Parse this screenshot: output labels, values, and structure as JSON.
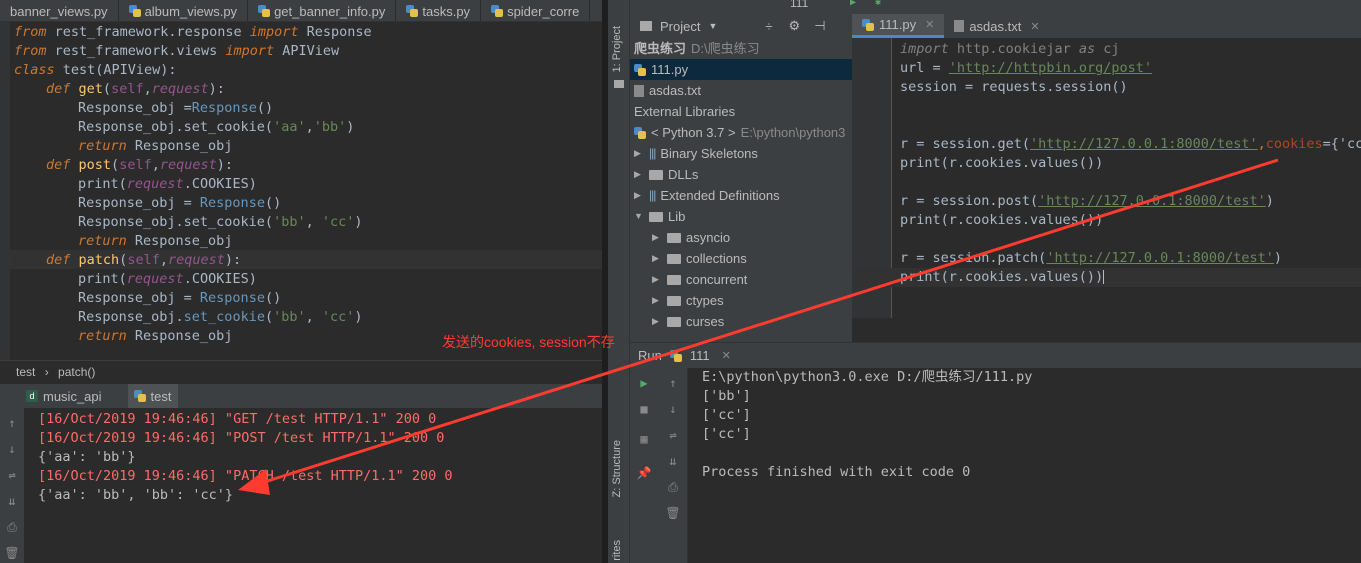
{
  "left_editor": {
    "tabs": [
      {
        "label": "banner_views.py"
      },
      {
        "label": "album_views.py"
      },
      {
        "label": "get_banner_info.py"
      },
      {
        "label": "tasks.py"
      },
      {
        "label": "spider_corre"
      }
    ],
    "code": {
      "l1": {
        "kw": "from",
        "mod": " rest_framework.response ",
        "imp": "import",
        "name": " Response"
      },
      "l2": {
        "kw": "from",
        "mod": " rest_framework.views ",
        "imp": "import",
        "name": " APIView"
      },
      "l3": {
        "kw": "class",
        "name": " test(APIView):"
      },
      "l4": {
        "kw": "def",
        "fn": "get",
        "open": "(",
        "self": "self",
        "sep": ",",
        "param": "request",
        "close": "):"
      },
      "l5": {
        "text": "Response_obj =",
        "cls": "Response",
        "tail": "()"
      },
      "l6": {
        "head": "Response_obj.set_cookie(",
        "a": "'aa'",
        "sep": ",",
        "b": "'bb'",
        "tail": ")"
      },
      "l7": {
        "kw": "return",
        "tail": " Response_obj"
      },
      "l8": {
        "kw": "def",
        "fn": "post",
        "open": "(",
        "self": "self",
        "sep": ",",
        "param": "request",
        "close": "):"
      },
      "l9": {
        "head": "print(",
        "param": "request",
        "tail": ".COOKIES)"
      },
      "l10": {
        "text": "Response_obj = ",
        "cls": "Response",
        "tail": "()"
      },
      "l11": {
        "head": "Response_obj.set_cookie(",
        "a": "'bb'",
        "sep": ", ",
        "b": "'cc'",
        "tail": ")"
      },
      "l12": {
        "kw": "return",
        "tail": " Response_obj"
      },
      "l13": {
        "kw": "def",
        "fn": "patch",
        "open": "(",
        "self": "self",
        "sep": ",",
        "param": "request",
        "close": "):"
      },
      "l14": {
        "head": "print(",
        "param": "request",
        "tail": ".COOKIES)"
      },
      "l15": {
        "text": "Response_obj = ",
        "cls": "Response",
        "tail": "()"
      },
      "l16": {
        "head": "Response_obj.",
        "fn": "set_cookie",
        "open": "(",
        "a": "'bb'",
        "sep": ", ",
        "b": "'cc'",
        "tail": ")"
      },
      "l17": {
        "kw": "return",
        "tail": " Response_obj"
      }
    },
    "breadcrumb": {
      "a": "test",
      "sep": "›",
      "b": "patch()"
    }
  },
  "left_run": {
    "tabs": [
      {
        "label": "music_api"
      },
      {
        "label": "test"
      }
    ],
    "lines": [
      "[16/Oct/2019 19:46:46] \"GET /test HTTP/1.1\" 200 0",
      "[16/Oct/2019 19:46:46] \"POST /test HTTP/1.1\" 200 0",
      "{'aa': 'bb'}",
      "[16/Oct/2019 19:46:46] \"PATCH /test HTTP/1.1\" 200 0",
      "{'aa': 'bb', 'bb': 'cc'}"
    ]
  },
  "annotation": "发送的cookies, session不存",
  "right_ide": {
    "stripe": {
      "project": "1: Project",
      "structure": "Z: Structure",
      "favorites": "rites"
    },
    "toolbar_run_config": "111",
    "project_panel": {
      "title": "Project",
      "items": [
        {
          "label": "爬虫练习",
          "path": "D:\\爬虫练习"
        },
        {
          "label": "111.py"
        },
        {
          "label": "asdas.txt"
        },
        {
          "label": "External Libraries"
        },
        {
          "label": "< Python 3.7 >",
          "path": "E:\\python\\python3"
        },
        {
          "label": "Binary Skeletons"
        },
        {
          "label": "DLLs"
        },
        {
          "label": "Extended Definitions"
        },
        {
          "label": "Lib"
        },
        {
          "label": "asyncio"
        },
        {
          "label": "collections"
        },
        {
          "label": "concurrent"
        },
        {
          "label": "ctypes"
        },
        {
          "label": "curses"
        }
      ]
    },
    "editor_tabs": [
      {
        "label": "111.py"
      },
      {
        "label": "asdas.txt"
      }
    ],
    "code": {
      "l1": {
        "kw": "import",
        "rest": " http.cookiejar ",
        "as": "as",
        "name": " cj"
      },
      "l2": {
        "head": "url = ",
        "url": "'http://httpbin.org/post'"
      },
      "l3": {
        "text": "session = requests.session()"
      },
      "l4": {
        "head": "r = session.get(",
        "url": "'http://127.0.0.1:8000/test'",
        "sep": ",",
        "kwarg": "cookies",
        "tail": "={'cc"
      },
      "l5": {
        "text": "print(r.cookies.values())"
      },
      "l6": {
        "head": "r = session.post(",
        "url": "'http://127.0.0.1:8000/test'",
        "tail": ")"
      },
      "l7": {
        "text": "print(r.cookies.values())"
      },
      "l8": {
        "head": "r = session.patch(",
        "url": "'http://127.0.0.1:8000/test'",
        "tail": ")"
      },
      "l9": {
        "text": "print(r.cookies.values())"
      }
    },
    "run": {
      "label": "Run",
      "config": "111",
      "lines": [
        "E:\\python\\python3.0.exe D:/爬虫练习/111.py",
        "['bb']",
        "['cc']",
        "['cc']",
        "",
        "Process finished with exit code 0"
      ]
    }
  },
  "colors": {
    "annotation": "#ff3b30",
    "log_red": "#ff6b68",
    "selection": "#0d293e"
  }
}
